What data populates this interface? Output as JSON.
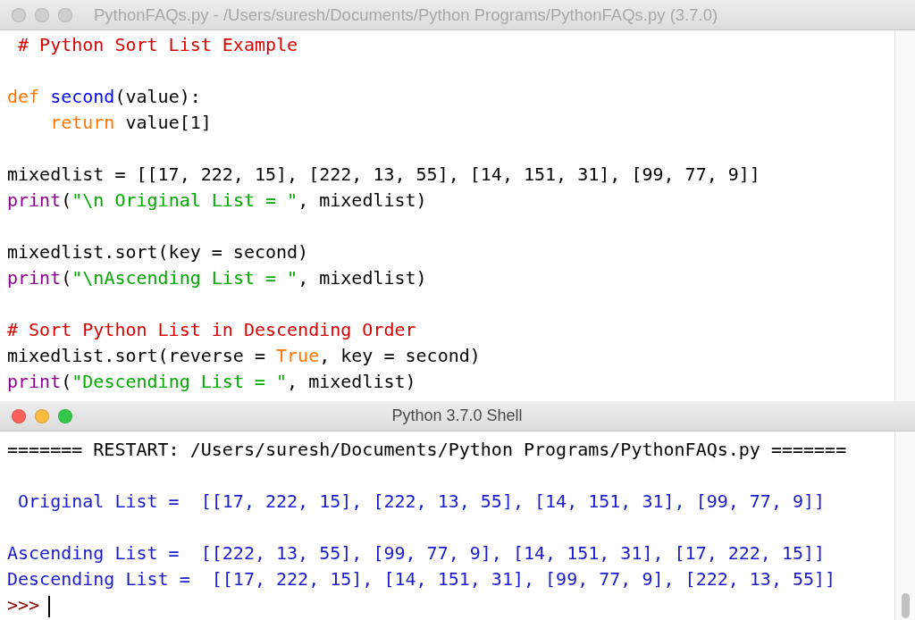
{
  "editor": {
    "title": "PythonFAQs.py - /Users/suresh/Documents/Python Programs/PythonFAQs.py (3.7.0)",
    "active": false,
    "blocks": [
      [
        [
          {
            "kind": "comment",
            "text": " # Python Sort List Example"
          }
        ]
      ],
      [
        [
          {
            "kind": "keyword",
            "text": "def"
          },
          {
            "kind": "defname",
            "text": " second"
          },
          {
            "kind": "plain",
            "text": "(value):"
          }
        ],
        [
          {
            "kind": "keyword",
            "text": "    return"
          },
          {
            "kind": "plain",
            "text": " value[1]"
          }
        ]
      ],
      [
        [
          {
            "kind": "plain",
            "text": "mixedlist = [[17, 222, 15], [222, 13, 55], [14, 151, 31], [99, 77, 9]]"
          }
        ],
        [
          {
            "kind": "builtin",
            "text": "print"
          },
          {
            "kind": "plain",
            "text": "("
          },
          {
            "kind": "string",
            "text": "\"\\n Original List = \""
          },
          {
            "kind": "plain",
            "text": ", mixedlist)"
          }
        ]
      ],
      [
        [
          {
            "kind": "plain",
            "text": "mixedlist.sort(key = second)"
          }
        ],
        [
          {
            "kind": "builtin",
            "text": "print"
          },
          {
            "kind": "plain",
            "text": "("
          },
          {
            "kind": "string",
            "text": "\"\\nAscending List = \""
          },
          {
            "kind": "plain",
            "text": ", mixedlist)"
          }
        ]
      ],
      [
        [
          {
            "kind": "comment",
            "text": "# Sort Python List in Descending Order"
          }
        ],
        [
          {
            "kind": "plain",
            "text": "mixedlist.sort(reverse = "
          },
          {
            "kind": "keyword",
            "text": "True"
          },
          {
            "kind": "plain",
            "text": ", key = second)"
          }
        ],
        [
          {
            "kind": "builtin",
            "text": "print"
          },
          {
            "kind": "plain",
            "text": "("
          },
          {
            "kind": "string",
            "text": "\"Descending List = \""
          },
          {
            "kind": "plain",
            "text": ", mixedlist)"
          }
        ]
      ]
    ]
  },
  "shell": {
    "title": "Python 3.7.0 Shell",
    "active": true,
    "blocks": [
      [
        {
          "kind": "restart",
          "text": "======= RESTART: /Users/suresh/Documents/Python Programs/PythonFAQs.py ======="
        }
      ],
      [
        {
          "kind": "output",
          "text": " Original List =  [[17, 222, 15], [222, 13, 55], [14, 151, 31], [99, 77, 9]]"
        }
      ],
      [
        {
          "kind": "output",
          "text": "Ascending List =  [[222, 13, 55], [99, 77, 9], [14, 151, 31], [17, 222, 15]]"
        },
        {
          "kind": "output",
          "text": "Descending List =  [[17, 222, 15], [14, 151, 31], [99, 77, 9], [222, 13, 55]]"
        }
      ]
    ],
    "prompt": ">>>"
  }
}
